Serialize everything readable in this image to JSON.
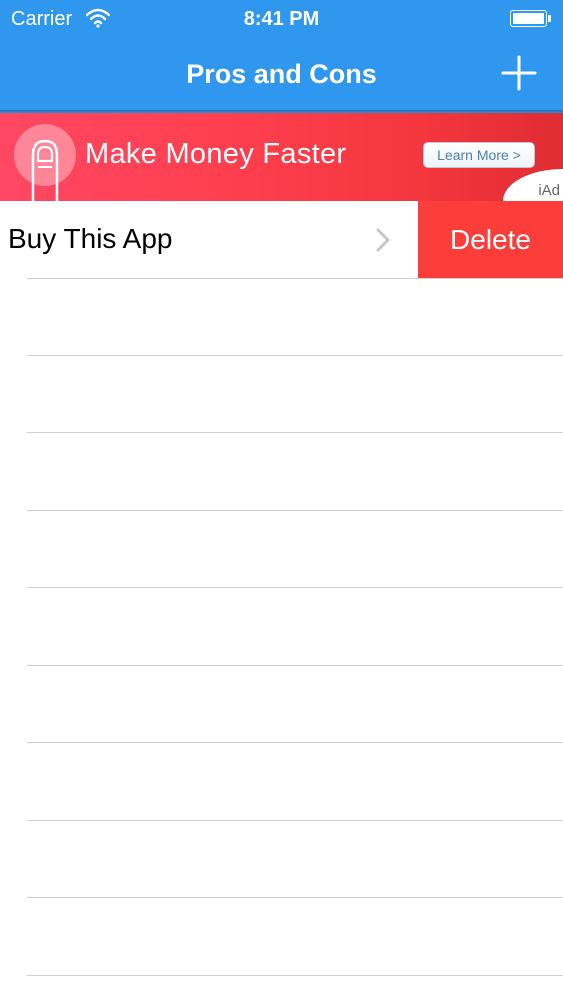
{
  "status_bar": {
    "carrier": "Carrier",
    "time": "8:41 PM",
    "battery_level": 1.0,
    "wifi_icon": "wifi-icon",
    "battery_icon": "battery-icon"
  },
  "nav_bar": {
    "title": "Pros and Cons",
    "add_icon": "plus-icon",
    "color": "#2f97ee"
  },
  "ad": {
    "headline": "Make Money Faster",
    "button_label": "Learn More >",
    "badge": "iAd",
    "icon": "finger-tap-icon"
  },
  "list": {
    "items": [
      {
        "label": "Buy This App",
        "delete_label": "Delete",
        "chevron_icon": "chevron-right-icon"
      }
    ],
    "delete_color": "#fc3d39"
  }
}
